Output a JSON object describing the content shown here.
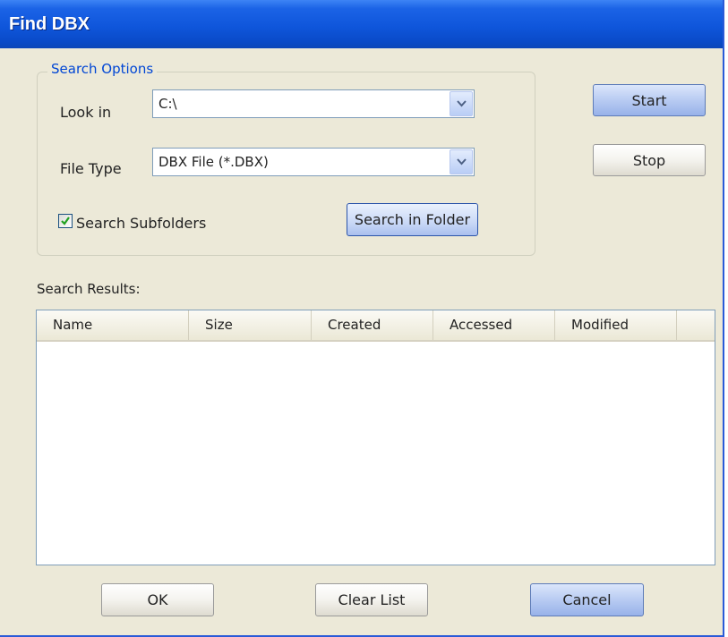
{
  "window": {
    "title": "Find DBX"
  },
  "search_options": {
    "legend": "Search Options",
    "look_in": {
      "label": "Look in",
      "value": "C:\\"
    },
    "file_type": {
      "label": "File Type",
      "value": "DBX File (*.DBX)"
    },
    "search_subfolders": {
      "label": "Search Subfolders",
      "checked": true
    },
    "search_in_folder_label": "Search in Folder"
  },
  "actions": {
    "start_label": "Start",
    "stop_label": "Stop"
  },
  "results": {
    "label": "Search Results:",
    "columns": [
      "Name",
      "Size",
      "Created",
      "Accessed",
      "Modified"
    ],
    "rows": []
  },
  "footer": {
    "ok_label": "OK",
    "clear_list_label": "Clear List",
    "cancel_label": "Cancel"
  },
  "colors": {
    "title_bar": "#0f56db",
    "dialog_bg": "#ece9d8",
    "group_legend": "#0046d5"
  }
}
